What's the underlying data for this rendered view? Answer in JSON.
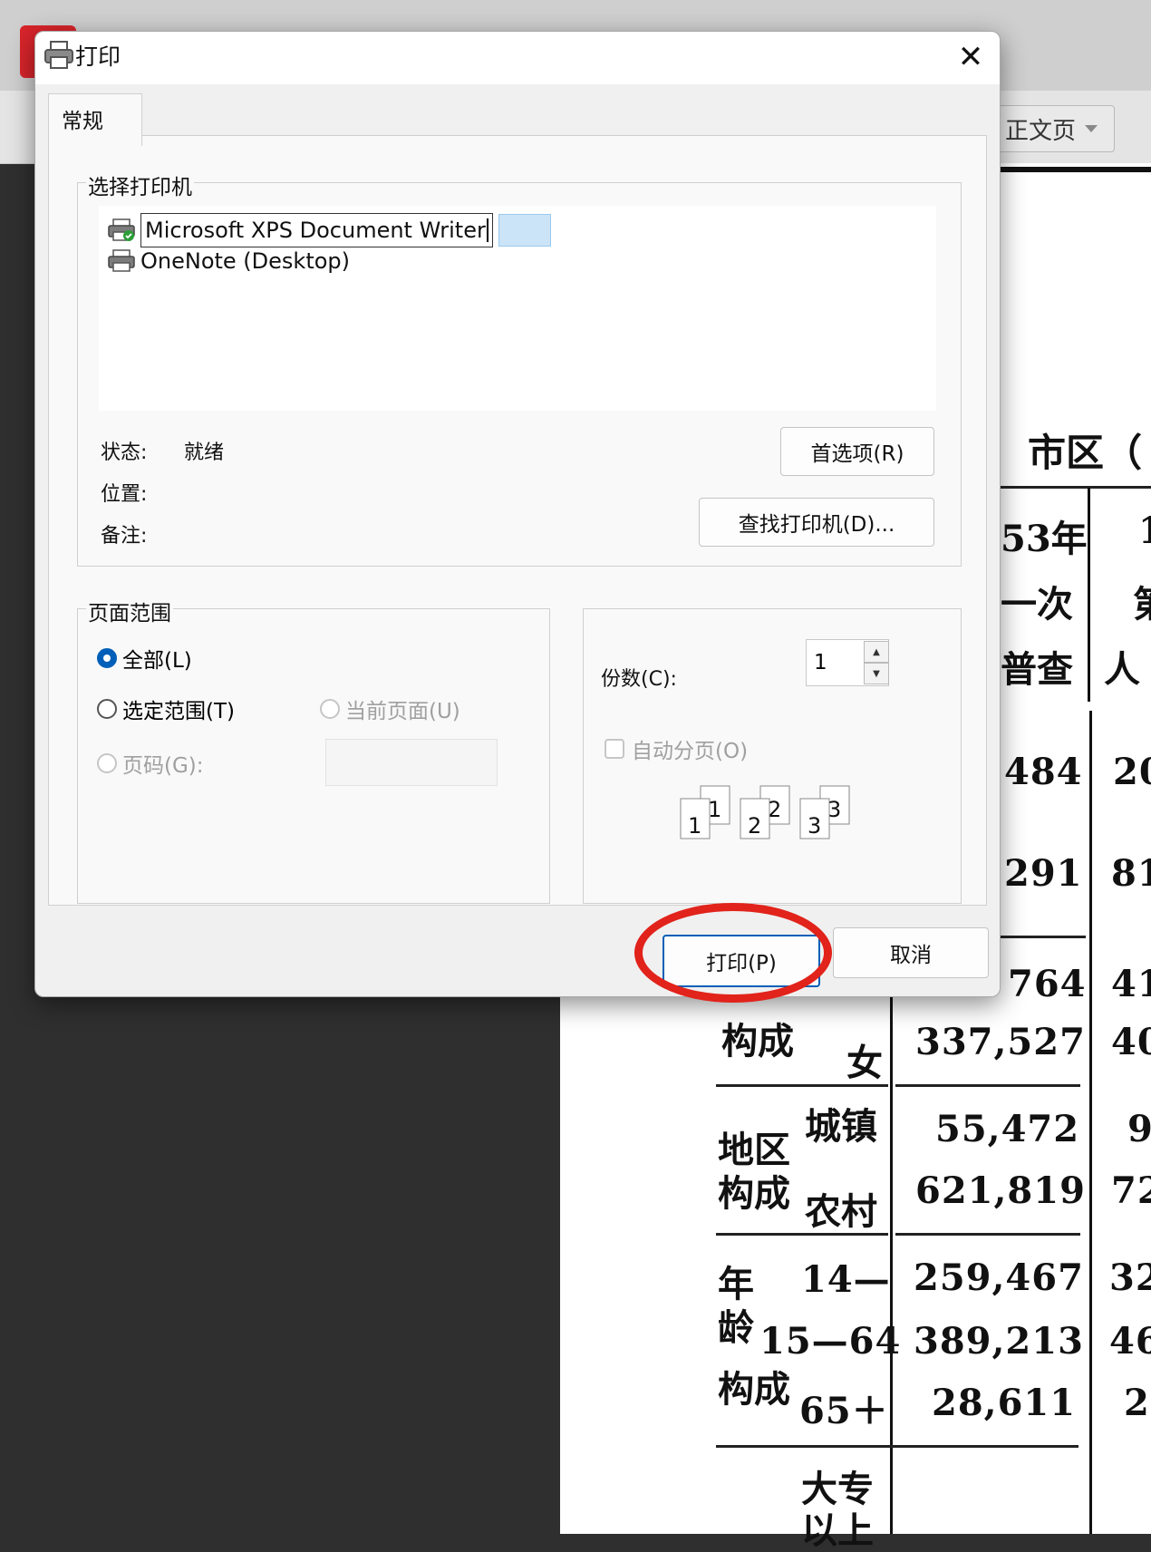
{
  "background_app": {
    "view_dropdown": "正文页",
    "document": {
      "title": "市区（",
      "header_cells": [
        "53年",
        "一次",
        "普查",
        "1",
        "第",
        "人"
      ],
      "rows": [
        {
          "label": "",
          "value": "484",
          "next": "20"
        },
        {
          "label": "",
          "value": "291",
          "next": "81"
        },
        {
          "label": "",
          "value": "764",
          "next": "41"
        },
        {
          "label": "构成",
          "sub": "女",
          "value": "337,527",
          "next": "40"
        },
        {
          "label": "地区",
          "sub": "城镇",
          "value": "55,472",
          "next": "9"
        },
        {
          "label": "构成",
          "sub": "农村",
          "value": "621,819",
          "next": "72"
        },
        {
          "label": "年",
          "sub": "14—",
          "value": "259,467",
          "next": "32"
        },
        {
          "label": "龄",
          "sub": "15—64",
          "value": "389,213",
          "next": "46"
        },
        {
          "label": "构成",
          "sub": "65＋",
          "value": "28,611",
          "next": "2"
        },
        {
          "label": "",
          "sub": "大专以上",
          "value": "",
          "next": ""
        }
      ]
    }
  },
  "dialog": {
    "title": "打印",
    "close_glyph": "✕",
    "tab_general": "常规",
    "select_printer": {
      "legend": "选择打印机",
      "printers": [
        {
          "name": "Microsoft XPS Document Writer",
          "selected": true
        },
        {
          "name": "OneNote (Desktop)",
          "selected": false
        }
      ],
      "status_label": "状态:",
      "status_value": "就绪",
      "location_label": "位置:",
      "comment_label": "备注:",
      "preferences_button": "首选项(R)",
      "find_printer_button": "查找打印机(D)..."
    },
    "page_range": {
      "legend": "页面范围",
      "all": "全部(L)",
      "selection": "选定范围(T)",
      "current_page": "当前页面(U)",
      "pages": "页码(G):",
      "selected_option": "all"
    },
    "copies": {
      "label": "份数(C):",
      "value": "1",
      "collate_label": "自动分页(O)",
      "collate_checked": false,
      "collate_pages": [
        "1",
        "1",
        "2",
        "2",
        "3",
        "3"
      ]
    },
    "print_button": "打印(P)",
    "cancel_button": "取消",
    "highlight_color": "#e1231b"
  }
}
